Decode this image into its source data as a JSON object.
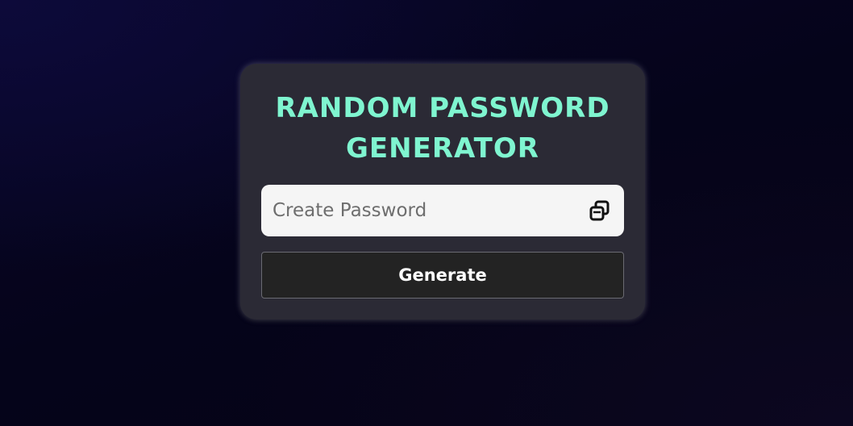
{
  "app": {
    "title_line1": "RANDOM PASSWORD",
    "title_line2": "GENERATOR"
  },
  "password": {
    "value": "",
    "placeholder": "Create Password",
    "copy_icon": "copy-icon"
  },
  "actions": {
    "generate_label": "Generate"
  },
  "colors": {
    "title": "#7ff5d0",
    "card_background": "#2b2a35",
    "input_background": "#f5f5f5",
    "button_background": "#232323",
    "page_background": "#05041a"
  }
}
